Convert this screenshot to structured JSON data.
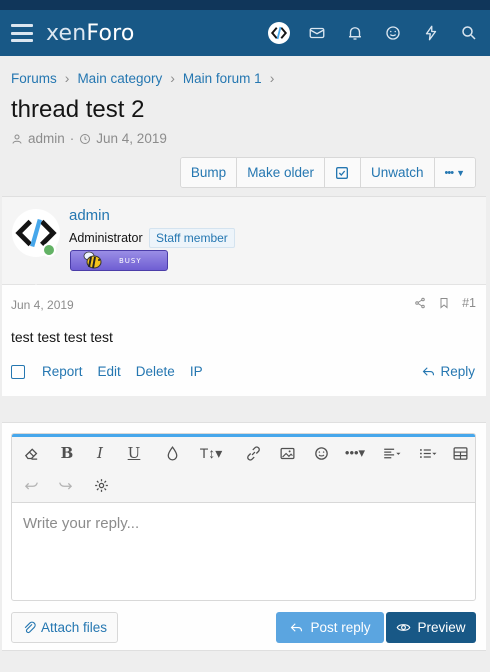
{
  "header": {
    "logo_main": "xen",
    "logo_accent": "Foro",
    "icons": [
      "menu-icon",
      "avatar",
      "envelope-icon",
      "bell-icon",
      "smile-icon",
      "bolt-icon",
      "search-icon"
    ]
  },
  "breadcrumbs": [
    "Forums",
    "Main category",
    "Main forum 1"
  ],
  "thread": {
    "title": "thread test 2",
    "author": "admin",
    "date": "Jun 4, 2019"
  },
  "thread_actions": {
    "bump": "Bump",
    "make_older": "Make older",
    "unwatch": "Unwatch",
    "more": "•••"
  },
  "post": {
    "username": "admin",
    "user_title": "Administrator",
    "staff_badge": "Staff member",
    "banner_text": "BUSY",
    "date": "Jun 4, 2019",
    "number": "#1",
    "body": "test test test test",
    "actions": [
      "Report",
      "Edit",
      "Delete",
      "IP"
    ],
    "reply": "Reply"
  },
  "editor": {
    "placeholder": "Write your reply..."
  },
  "reply_buttons": {
    "attach": "Attach files",
    "post_reply": "Post reply",
    "preview": "Preview"
  },
  "colors": {
    "header_bg": "#185886",
    "link": "#2577b1",
    "post_reply_bg": "#5ba5e0",
    "preview_bg": "#185886"
  }
}
